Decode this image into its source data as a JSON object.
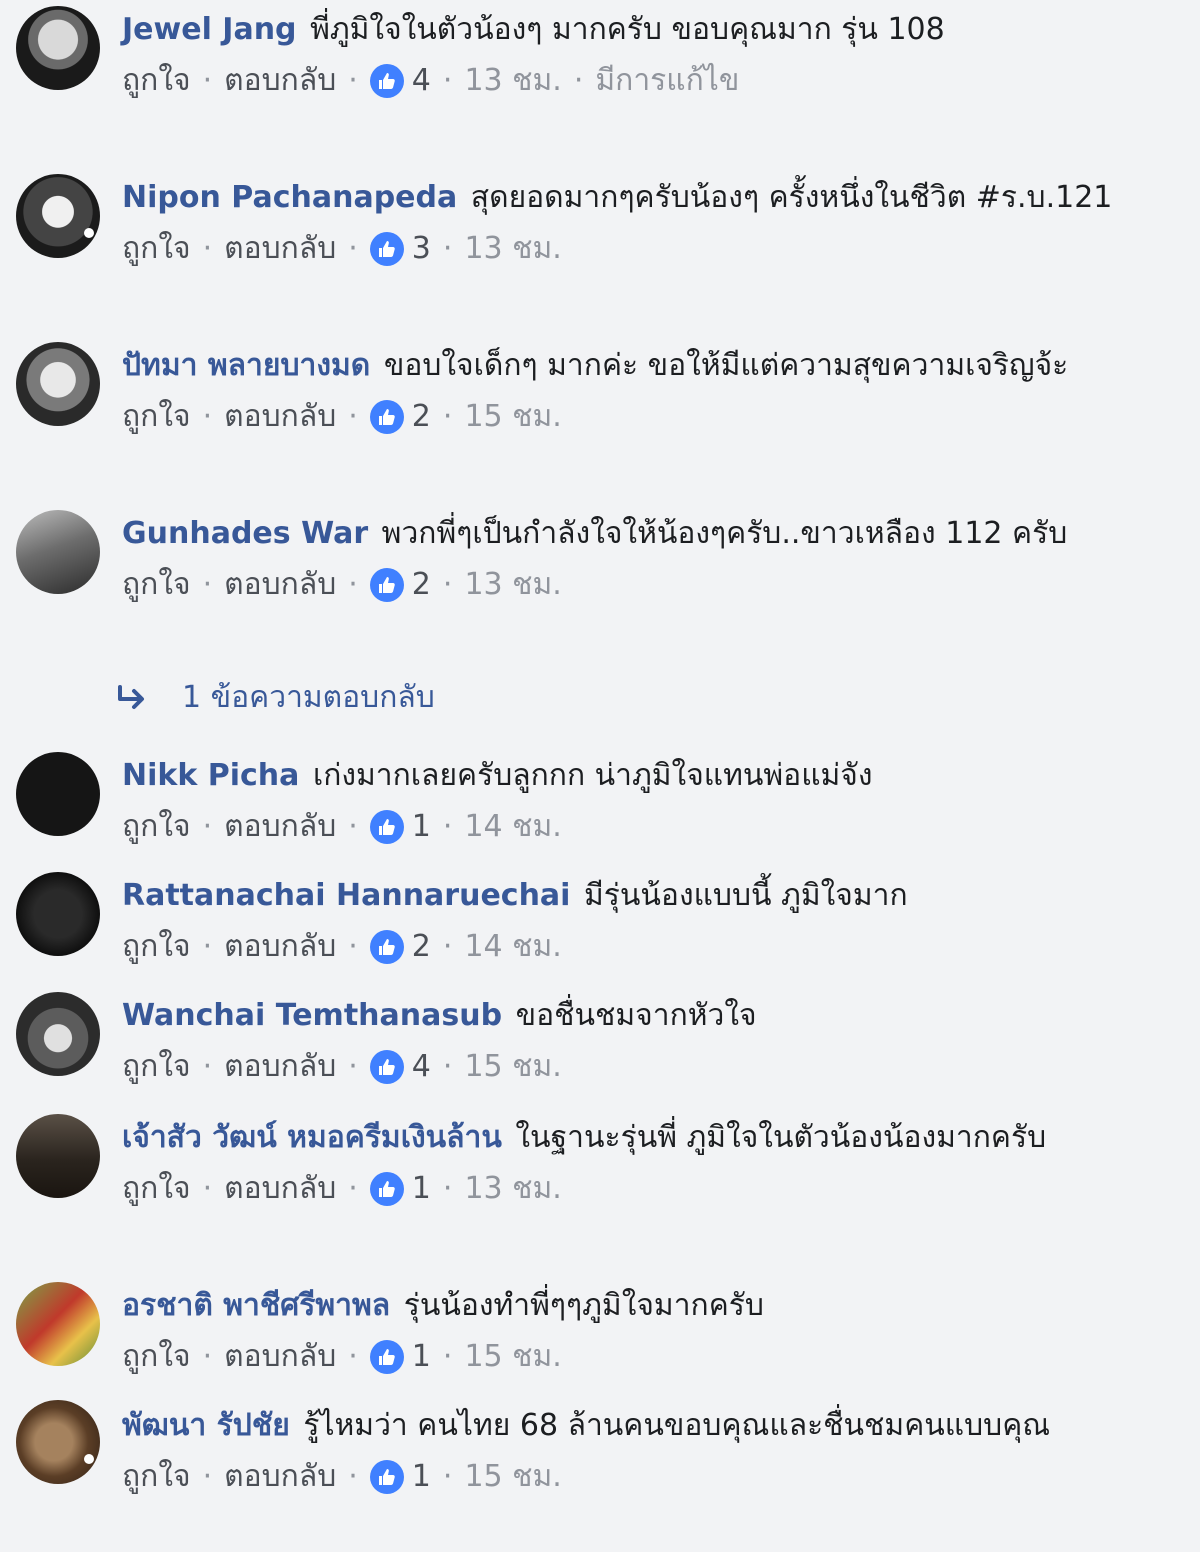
{
  "ui": {
    "like_label": "ถูกใจ",
    "reply_label": "ตอบกลับ",
    "separator": "·",
    "edited_label": "มีการแก้ไข",
    "like_badge_color": "#4080ff",
    "author_color": "#385898"
  },
  "comments": [
    {
      "author": "Jewel Jang",
      "text": "พี่ภูมิใจในตัวน้องๆ มากครับ ขอบคุณมาก รุ่น 108",
      "likes": "4",
      "time": "13 ชม.",
      "edited": true,
      "avatar": "avatar-photo"
    },
    {
      "author": "Nipon Pachanapeda",
      "text": "สุดยอดมากๆครับน้องๆ ครั้งหนึ่งในชีวิต #ร.บ.121",
      "likes": "3",
      "time": "13 ชม.",
      "edited": false,
      "avatar": "avatar-photo"
    },
    {
      "author": "ปัทมา พลายบางมด",
      "text": "ขอบใจเด็กๆ มากค่ะ ขอให้มีแต่ความสุขความเจริญจ้ะ",
      "likes": "2",
      "time": "15 ชม.",
      "edited": false,
      "avatar": "avatar-photo"
    },
    {
      "author": "Gunhades War",
      "text": "พวกพี่ๆเป็นกำลังใจให้น้องๆครับ..ขาวเหลือง 112 ครับ",
      "likes": "2",
      "time": "13 ชม.",
      "edited": false,
      "avatar": "avatar-photo"
    },
    {
      "author": "Nikk Picha",
      "text": "เก่งมากเลยครับลูกกก น่าภูมิใจแทนพ่อแม่จัง",
      "likes": "1",
      "time": "14 ชม.",
      "edited": false,
      "avatar": "avatar-photo"
    },
    {
      "author": "Rattanachai Hannaruechai",
      "text": "มีรุ่นน้องแบบนี้ ภูมิใจมาก",
      "likes": "2",
      "time": "14 ชม.",
      "edited": false,
      "avatar": "avatar-photo"
    },
    {
      "author": "Wanchai Temthanasub",
      "text": "ขอชื่นชมจากหัวใจ",
      "likes": "4",
      "time": "15 ชม.",
      "edited": false,
      "avatar": "avatar-photo"
    },
    {
      "author": "เจ้าสัว วัฒน์ หมอครีมเงินล้าน",
      "text": "ในฐานะรุ่นพี่ ภูมิใจในตัวน้องน้องมากครับ",
      "likes": "1",
      "time": "13 ชม.",
      "edited": false,
      "avatar": "avatar-photo"
    },
    {
      "author": "อรชาติ พาชีศรีพาพล",
      "text": "รุ่นน้องทำพี่ๆๆภูมิใจมากครับ",
      "likes": "1",
      "time": "15 ชม.",
      "edited": false,
      "avatar": "avatar-photo"
    },
    {
      "author": "พัฒนา รัปชัย",
      "text": "รู้ไหมว่า คนไทย 68 ล้านคนขอบคุณและชื่นชมคนแบบคุณ",
      "likes": "1",
      "time": "15 ชม.",
      "edited": false,
      "avatar": "avatar-photo"
    }
  ],
  "replies_link": {
    "label": "1 ข้อความตอบกลับ"
  }
}
